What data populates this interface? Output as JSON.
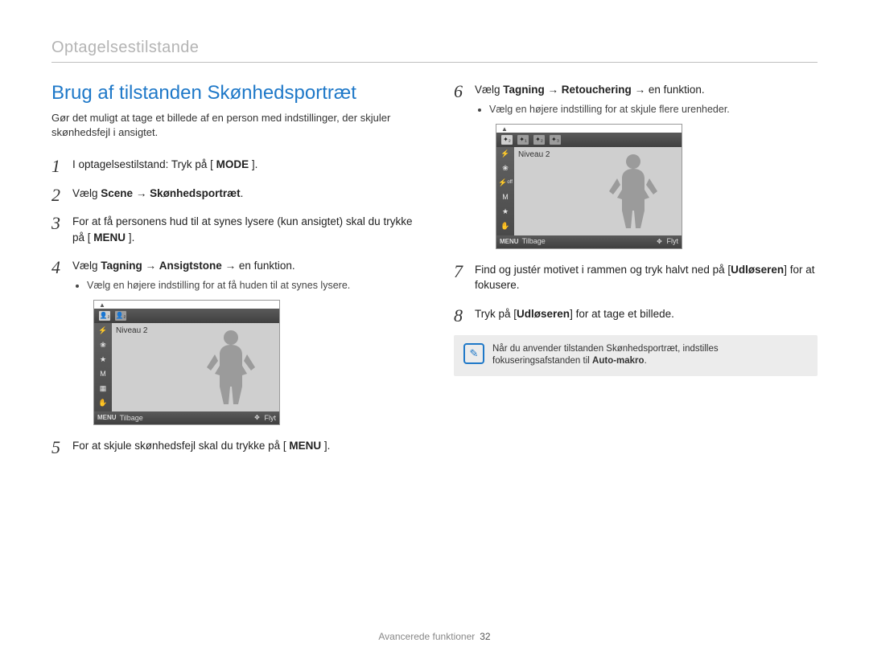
{
  "header": {
    "section": "Optagelsestilstande"
  },
  "left": {
    "title": "Brug af tilstanden Skønhedsportræt",
    "intro": "Gør det muligt at tage et billede af en person med indstillinger, der skjuler skønhedsfejl i ansigtet.",
    "steps": [
      {
        "num": "1",
        "text_a": "I optagelsestilstand: Tryk på ",
        "key": "MODE"
      },
      {
        "num": "2",
        "prefix": "Vælg",
        "bold_a": "Scene",
        "bold_b": "Skønhedsportræt"
      },
      {
        "num": "3",
        "text_a": "For at få personens hud til at synes lysere (kun ansigtet) skal du trykke på ",
        "key": "MENU"
      },
      {
        "num": "4",
        "prefix": "Vælg",
        "bold_a": "Tagning",
        "bold_b": "Ansigtstone",
        "suffix": "en funktion.",
        "bullet": "Vælg en højere indstilling for at få huden til at synes lysere."
      },
      {
        "num": "5",
        "text_a": "For at skjule skønhedsfejl skal du trykke på ",
        "key": "MENU"
      }
    ]
  },
  "right": {
    "steps": [
      {
        "num": "6",
        "prefix": "Vælg",
        "bold_a": "Tagning",
        "bold_b": "Retouchering",
        "suffix": "en funktion.",
        "bullet": "Vælg en højere indstilling for at skjule flere urenheder."
      },
      {
        "num": "7",
        "text_a": "Find og justér motivet i rammen og tryk halvt ned på ",
        "key": "Udløseren",
        "text_b": " for at fokusere."
      },
      {
        "num": "8",
        "text_a": "Tryk på ",
        "key": "Udløseren",
        "text_b": " for at tage et billede."
      }
    ]
  },
  "cam": {
    "level_label": "Niveau 2",
    "menu": "MENU",
    "back": "Tilbage",
    "move": "Flyt"
  },
  "note": {
    "text_a": "Når du anvender tilstanden Skønhedsportræt, indstilles fokuseringsafstanden til",
    "bold": "Auto-makro",
    "text_b": "."
  },
  "footer": {
    "label": "Avancerede funktioner",
    "page": "32"
  }
}
